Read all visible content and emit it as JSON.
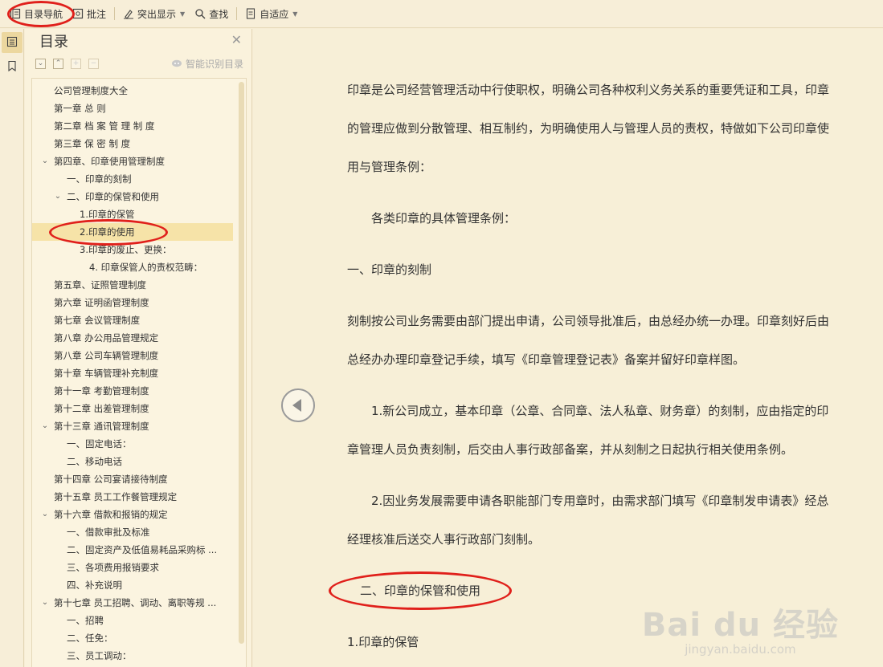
{
  "toolbar": {
    "nav_label": "目录导航",
    "annotate_label": "批注",
    "highlight_label": "突出显示",
    "find_label": "查找",
    "fit_label": "自适应",
    "icons": [
      "doc-nav-icon",
      "annotate-icon",
      "highlight-icon",
      "search-icon",
      "fit-page-icon"
    ]
  },
  "rail": {
    "items": [
      "toc-icon",
      "bookmark-icon"
    ]
  },
  "nav": {
    "title": "目录",
    "smart_label": "智能识别目录",
    "tree": [
      {
        "label": "公司管理制度大全",
        "level": 0,
        "toggle": ""
      },
      {
        "label": "第一章 总 则",
        "level": 0,
        "toggle": ""
      },
      {
        "label": "第二章 档 案 管 理 制 度",
        "level": 0,
        "toggle": ""
      },
      {
        "label": "第三章 保 密 制 度",
        "level": 0,
        "toggle": ""
      },
      {
        "label": "第四章、印章使用管理制度",
        "level": 0,
        "toggle": "v"
      },
      {
        "label": "一、印章的刻制",
        "level": 1,
        "toggle": ""
      },
      {
        "label": "二、印章的保管和使用",
        "level": 1,
        "toggle": "v"
      },
      {
        "label": "1.印章的保管",
        "level": 2,
        "toggle": ""
      },
      {
        "label": "2.印章的使用",
        "level": 2,
        "toggle": "",
        "selected": true
      },
      {
        "label": "3.印章的废止、更换：",
        "level": 2,
        "toggle": ""
      },
      {
        "label": "4. 印章保管人的责权范畴：",
        "level": 3,
        "toggle": ""
      },
      {
        "label": "第五章、证照管理制度",
        "level": 0,
        "toggle": ""
      },
      {
        "label": "第六章 证明函管理制度",
        "level": 0,
        "toggle": ""
      },
      {
        "label": "第七章 会议管理制度",
        "level": 0,
        "toggle": ""
      },
      {
        "label": "第八章 办公用品管理规定",
        "level": 0,
        "toggle": ""
      },
      {
        "label": "第八章 公司车辆管理制度",
        "level": 0,
        "toggle": ""
      },
      {
        "label": "第十章 车辆管理补充制度",
        "level": 0,
        "toggle": ""
      },
      {
        "label": "第十一章 考勤管理制度",
        "level": 0,
        "toggle": ""
      },
      {
        "label": "第十二章 出差管理制度",
        "level": 0,
        "toggle": ""
      },
      {
        "label": "第十三章 通讯管理制度",
        "level": 0,
        "toggle": "v"
      },
      {
        "label": "一、固定电话：",
        "level": 1,
        "toggle": ""
      },
      {
        "label": "二、移动电话",
        "level": 1,
        "toggle": ""
      },
      {
        "label": "第十四章 公司宴请接待制度",
        "level": 0,
        "toggle": ""
      },
      {
        "label": "第十五章 员工工作餐管理规定",
        "level": 0,
        "toggle": ""
      },
      {
        "label": "第十六章 借款和报销的规定",
        "level": 0,
        "toggle": "v"
      },
      {
        "label": "一、借款审批及标准",
        "level": 1,
        "toggle": ""
      },
      {
        "label": "二、固定资产及低值易耗品采购标 ...",
        "level": 1,
        "toggle": ""
      },
      {
        "label": "三、各项费用报销要求",
        "level": 1,
        "toggle": ""
      },
      {
        "label": "四、补充说明",
        "level": 1,
        "toggle": ""
      },
      {
        "label": "第十七章 员工招聘、调动、离职等规 ...",
        "level": 0,
        "toggle": "v"
      },
      {
        "label": "一、招聘",
        "level": 1,
        "toggle": ""
      },
      {
        "label": "二、任免：",
        "level": 1,
        "toggle": ""
      },
      {
        "label": "三、员工调动：",
        "level": 1,
        "toggle": ""
      }
    ]
  },
  "document": {
    "paragraphs": [
      "印章是公司经营管理活动中行使职权，明确公司各种权利义务关系的重要凭证和工具，印章",
      "的管理应做到分散管理、相互制约，为明确使用人与管理人员的责权，特做如下公司印章使",
      "用与管理条例：",
      "各类印章的具体管理条例：",
      "一、印章的刻制",
      "刻制按公司业务需要由部门提出申请，公司领导批准后，由总经办统一办理。印章刻好后由",
      "总经办办理印章登记手续，填写《印章管理登记表》备案并留好印章样图。",
      "1.新公司成立，基本印章（公章、合同章、法人私章、财务章）的刻制，应由指定的印",
      "章管理人员负责刻制，后交由人事行政部备案，并从刻制之日起执行相关使用条例。",
      "2.因业务发展需要申请各职能部门专用章时，由需求部门填写《印章制发申请表》经总",
      "经理核准后送交人事行政部门刻制。",
      "二、印章的保管和使用",
      "1.印章的保管"
    ]
  },
  "watermark": {
    "main": "Bai du 经验",
    "sub": "jingyan.baidu.com"
  },
  "colors": {
    "annotation": "#e0201b",
    "selected_row": "#f6e3a8",
    "background": "#f7efd7"
  }
}
